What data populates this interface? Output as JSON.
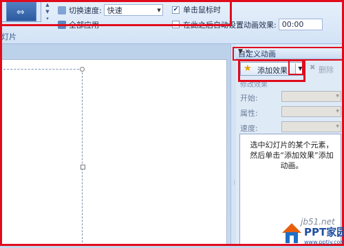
{
  "ribbon": {
    "speed_label": "切换速度:",
    "speed_value": "快速",
    "apply_all_label": "全部应用",
    "on_click_label": "单击鼠标时",
    "on_click_checked": "✔",
    "auto_after_label": "在此之后自动设置动画效果:",
    "auto_after_value": "00:00",
    "group_label": "灯片"
  },
  "panel": {
    "title": "自定义动画",
    "title_controls": "▼ ×",
    "add_effect_label": "添加效果",
    "remove_label": "删除",
    "modify_label": "修改效果",
    "properties": [
      {
        "label": "开始:"
      },
      {
        "label": "属性:"
      },
      {
        "label": "速度:"
      }
    ],
    "message": "选中幻灯片的某个元素，然后单击“添加效果”添加动画。"
  },
  "watermark": {
    "site": "jb51.net",
    "brand": "PPT家园",
    "domain": "www.pptjy.com"
  },
  "colors": {
    "highlight_red": "#e00b1c",
    "ribbon_bg": "#d3e3f6",
    "panel_bg": "#dfeaf7"
  }
}
